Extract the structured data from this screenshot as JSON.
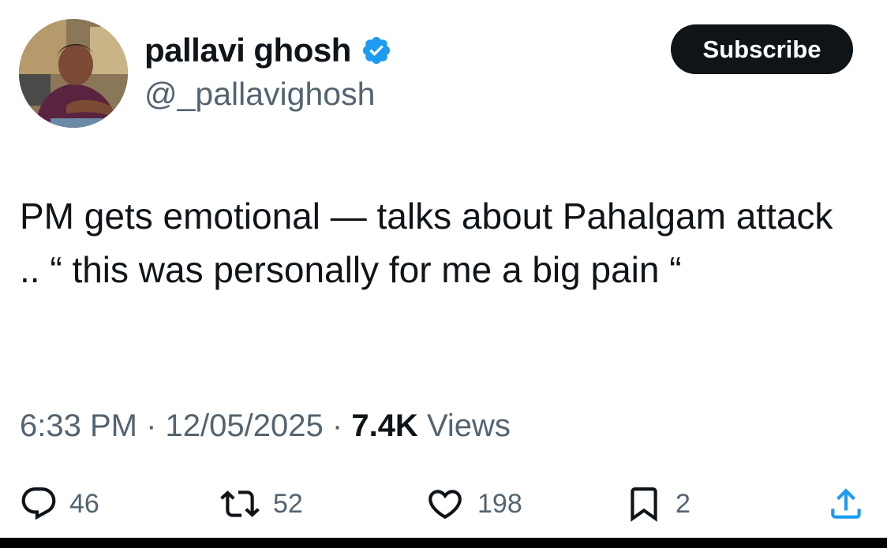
{
  "author": {
    "display_name": "pallavi ghosh",
    "handle": "@_pallavighosh",
    "verified": true,
    "avatar_icon": "profile-photo"
  },
  "subscribe_label": "Subscribe",
  "tweet": {
    "text": "PM gets emotional — talks about Pahalgam attack .. “ this was personally for me a big pain “",
    "time": "6:33 PM",
    "date": "12/05/2025",
    "views_count": "7.4K",
    "views_label": "Views",
    "separator": "·"
  },
  "actions": {
    "replies": {
      "icon": "reply-icon",
      "count": "46"
    },
    "retweets": {
      "icon": "retweet-icon",
      "count": "52"
    },
    "likes": {
      "icon": "heart-icon",
      "count": "198"
    },
    "bookmarks": {
      "icon": "bookmark-icon",
      "count": "2"
    },
    "share": {
      "icon": "share-icon"
    }
  },
  "colors": {
    "text_primary": "#0f1419",
    "text_secondary": "#536471",
    "verified_blue": "#1d9bf0",
    "subscribe_bg": "#0f1419"
  }
}
